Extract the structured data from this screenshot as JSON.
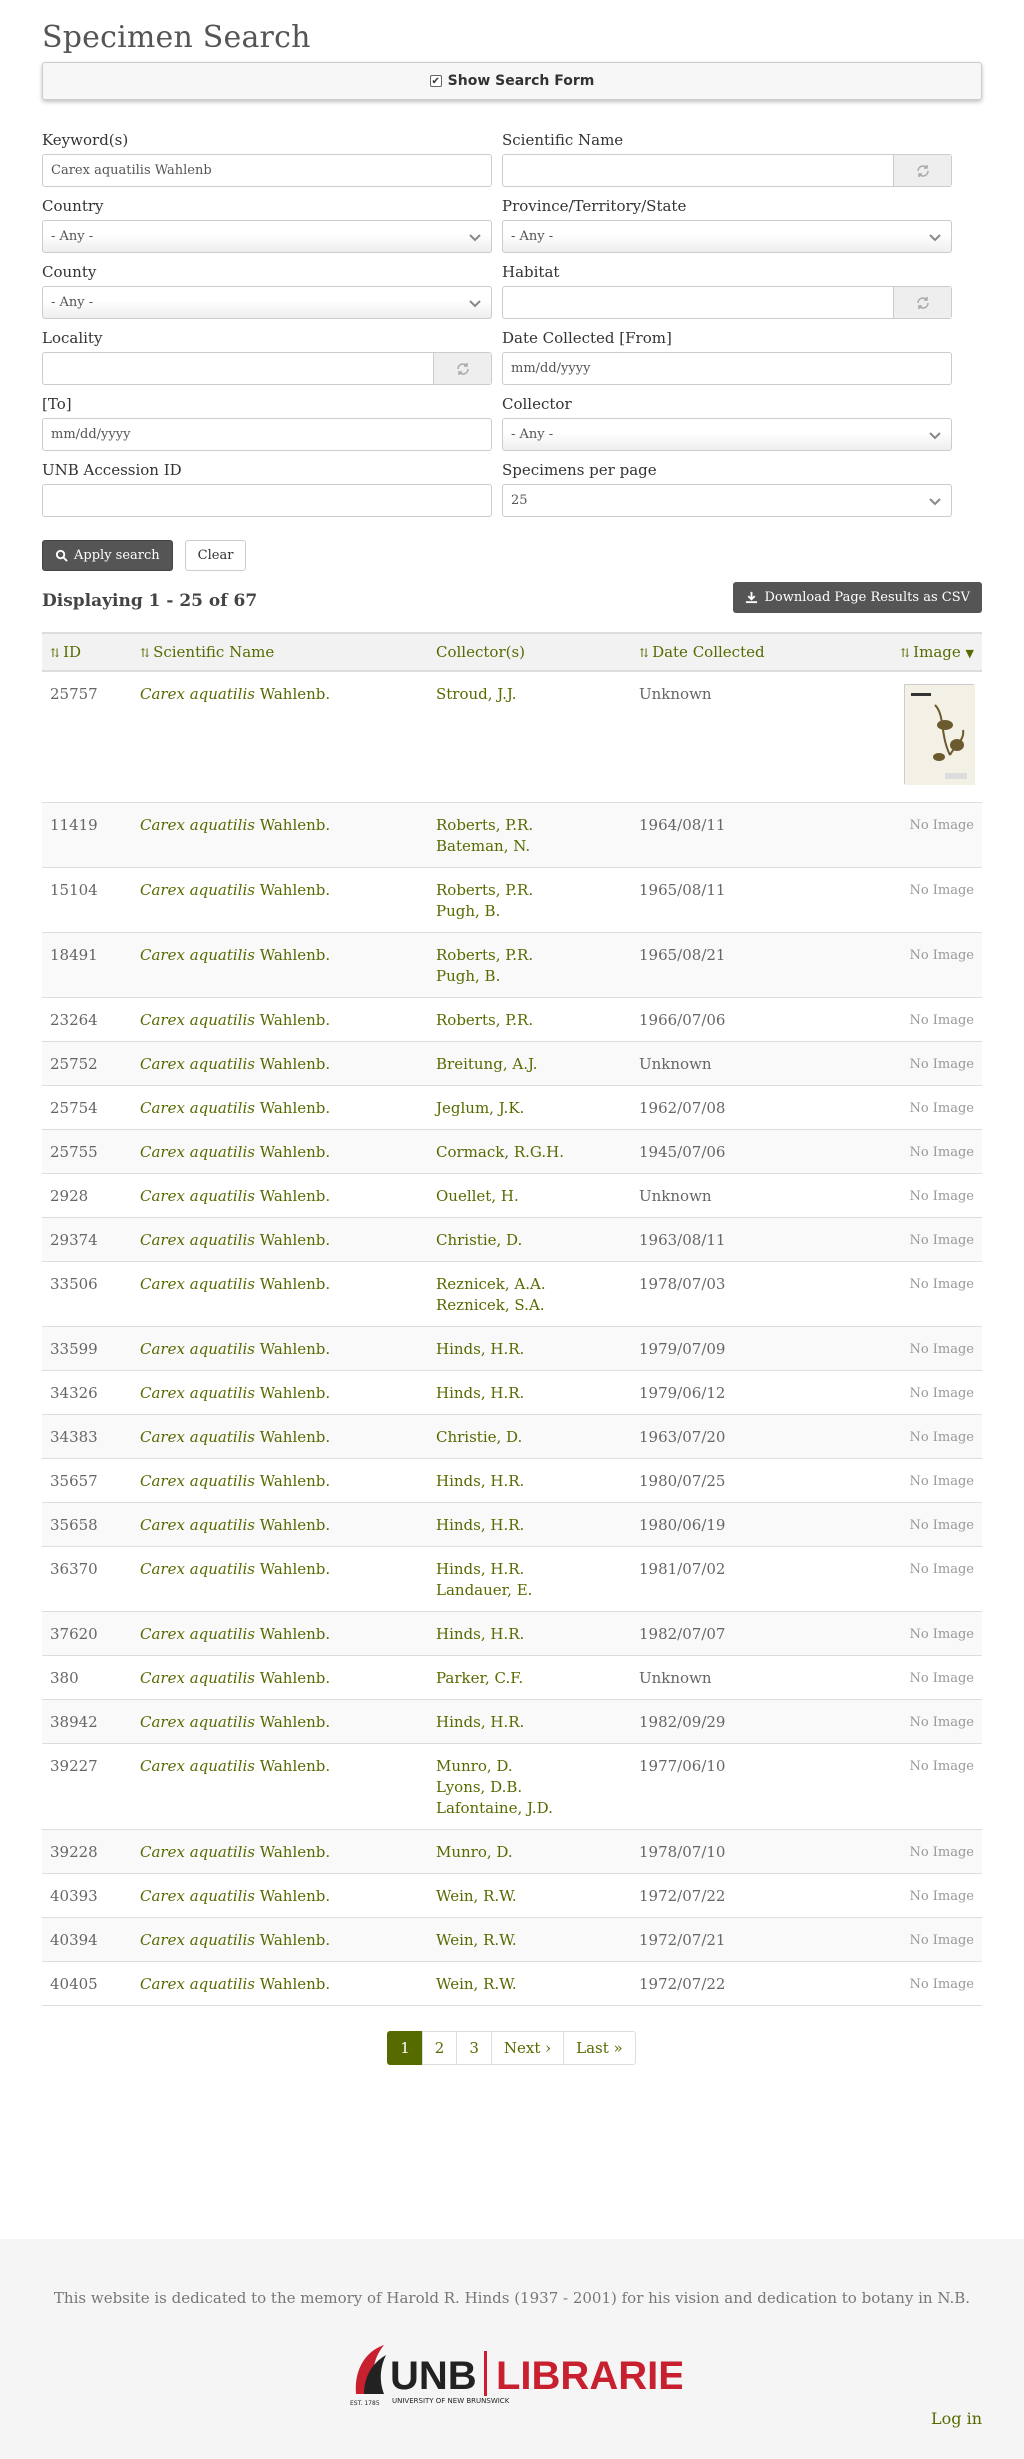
{
  "page_title": "Specimen Search",
  "toggle": {
    "label": "Show Search Form",
    "checked": true
  },
  "form": {
    "keyword": {
      "label": "Keyword(s)",
      "value": "Carex aquatilis Wahlenb"
    },
    "scientific_name": {
      "label": "Scientific Name",
      "value": ""
    },
    "country": {
      "label": "Country",
      "value": "- Any -"
    },
    "province": {
      "label": "Province/Territory/State",
      "value": "- Any -"
    },
    "county": {
      "label": "County",
      "value": "- Any -"
    },
    "habitat": {
      "label": "Habitat",
      "value": ""
    },
    "locality": {
      "label": "Locality",
      "value": ""
    },
    "date_from": {
      "label": "Date Collected [From]",
      "placeholder": "mm/dd/yyyy"
    },
    "date_to": {
      "label": "[To]",
      "placeholder": "mm/dd/yyyy"
    },
    "collector": {
      "label": "Collector",
      "value": "- Any -"
    },
    "accession": {
      "label": "UNB Accession ID",
      "value": ""
    },
    "per_page": {
      "label": "Specimens per page",
      "value": "25"
    },
    "apply_label": "Apply search",
    "clear_label": "Clear"
  },
  "results": {
    "summary": "Displaying 1 - 25 of 67",
    "download_label": "Download Page Results as CSV",
    "headers": {
      "id": "ID",
      "sci": "Scientific Name",
      "collector": "Collector(s)",
      "date": "Date Collected",
      "image": "Image"
    },
    "genus_species": "Carex aquatilis",
    "authority": "Wahlenb.",
    "no_image": "No Image",
    "rows": [
      {
        "id": "25757",
        "collectors": [
          "Stroud, J.J."
        ],
        "date": "Unknown",
        "has_image": true
      },
      {
        "id": "11419",
        "collectors": [
          "Roberts, P.R.",
          "Bateman, N."
        ],
        "date": "1964/08/11",
        "has_image": false
      },
      {
        "id": "15104",
        "collectors": [
          "Roberts, P.R.",
          "Pugh, B."
        ],
        "date": "1965/08/11",
        "has_image": false
      },
      {
        "id": "18491",
        "collectors": [
          "Roberts, P.R.",
          "Pugh, B."
        ],
        "date": "1965/08/21",
        "has_image": false
      },
      {
        "id": "23264",
        "collectors": [
          "Roberts, P.R."
        ],
        "date": "1966/07/06",
        "has_image": false
      },
      {
        "id": "25752",
        "collectors": [
          "Breitung, A.J."
        ],
        "date": "Unknown",
        "has_image": false
      },
      {
        "id": "25754",
        "collectors": [
          "Jeglum, J.K."
        ],
        "date": "1962/07/08",
        "has_image": false
      },
      {
        "id": "25755",
        "collectors": [
          "Cormack, R.G.H."
        ],
        "date": "1945/07/06",
        "has_image": false
      },
      {
        "id": "2928",
        "collectors": [
          "Ouellet, H."
        ],
        "date": "Unknown",
        "has_image": false
      },
      {
        "id": "29374",
        "collectors": [
          "Christie, D."
        ],
        "date": "1963/08/11",
        "has_image": false
      },
      {
        "id": "33506",
        "collectors": [
          "Reznicek, A.A.",
          "Reznicek, S.A."
        ],
        "date": "1978/07/03",
        "has_image": false
      },
      {
        "id": "33599",
        "collectors": [
          "Hinds, H.R."
        ],
        "date": "1979/07/09",
        "has_image": false
      },
      {
        "id": "34326",
        "collectors": [
          "Hinds, H.R."
        ],
        "date": "1979/06/12",
        "has_image": false
      },
      {
        "id": "34383",
        "collectors": [
          "Christie, D."
        ],
        "date": "1963/07/20",
        "has_image": false
      },
      {
        "id": "35657",
        "collectors": [
          "Hinds, H.R."
        ],
        "date": "1980/07/25",
        "has_image": false
      },
      {
        "id": "35658",
        "collectors": [
          "Hinds, H.R."
        ],
        "date": "1980/06/19",
        "has_image": false
      },
      {
        "id": "36370",
        "collectors": [
          "Hinds, H.R.",
          "Landauer, E."
        ],
        "date": "1981/07/02",
        "has_image": false
      },
      {
        "id": "37620",
        "collectors": [
          "Hinds, H.R."
        ],
        "date": "1982/07/07",
        "has_image": false
      },
      {
        "id": "380",
        "collectors": [
          "Parker, C.F."
        ],
        "date": "Unknown",
        "has_image": false
      },
      {
        "id": "38942",
        "collectors": [
          "Hinds, H.R."
        ],
        "date": "1982/09/29",
        "has_image": false
      },
      {
        "id": "39227",
        "collectors": [
          "Munro, D.",
          "Lyons, D.B.",
          "Lafontaine, J.D."
        ],
        "date": "1977/06/10",
        "has_image": false
      },
      {
        "id": "39228",
        "collectors": [
          "Munro, D."
        ],
        "date": "1978/07/10",
        "has_image": false
      },
      {
        "id": "40393",
        "collectors": [
          "Wein, R.W."
        ],
        "date": "1972/07/22",
        "has_image": false
      },
      {
        "id": "40394",
        "collectors": [
          "Wein, R.W."
        ],
        "date": "1972/07/21",
        "has_image": false
      },
      {
        "id": "40405",
        "collectors": [
          "Wein, R.W."
        ],
        "date": "1972/07/22",
        "has_image": false
      }
    ]
  },
  "pagination": {
    "pages": [
      "1",
      "2",
      "3"
    ],
    "active": "1",
    "next_label": "Next ›",
    "last_label": "Last »"
  },
  "footer": {
    "dedication": "This website is dedicated to the memory of Harold R. Hinds (1937 - 2001) for his vision and dedication to botany in N.B.",
    "logo_text": "UNB | LIBRARIES",
    "logo_subtext": "UNIVERSITY OF NEW BRUNSWICK",
    "logo_est": "EST. 1785",
    "login_label": "Log in"
  },
  "colors": {
    "link": "#556b00",
    "dark_button": "#555555",
    "brand_red": "#c8202f"
  }
}
